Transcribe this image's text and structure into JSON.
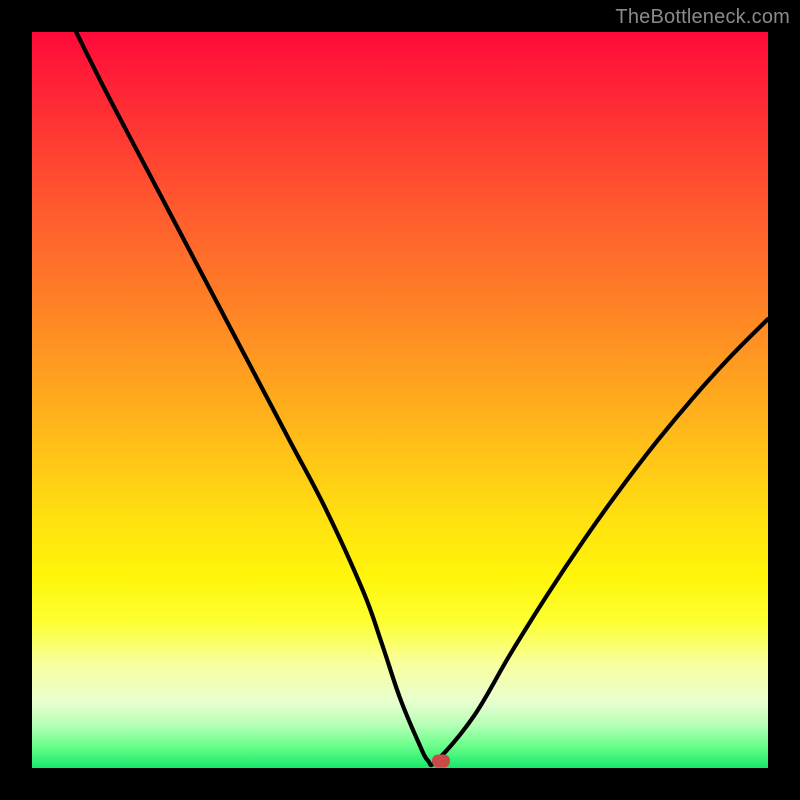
{
  "attribution": "TheBottleneck.com",
  "chart_data": {
    "type": "line",
    "title": "",
    "xlabel": "",
    "ylabel": "",
    "xlim": [
      0,
      100
    ],
    "ylim": [
      0,
      100
    ],
    "background_gradient": {
      "top": "#ff0a3a",
      "mid": "#ffe010",
      "bottom": "#17e86b"
    },
    "series": [
      {
        "name": "bottleneck-curve",
        "x": [
          6,
          10,
          15,
          20,
          25,
          30,
          35,
          40,
          45,
          47.5,
          50,
          52.5,
          53.8,
          55,
          60,
          65,
          70,
          75,
          80,
          85,
          90,
          95,
          100
        ],
        "y": [
          100,
          92,
          82.5,
          73,
          63.5,
          54,
          44.5,
          35,
          24,
          17,
          9.5,
          3.5,
          1.0,
          1.0,
          7,
          15.5,
          23.5,
          31,
          38,
          44.5,
          50.5,
          56,
          61
        ]
      }
    ],
    "flat_segment": {
      "x_start": 53.8,
      "x_end": 55.0,
      "y": 1.0
    },
    "marker": {
      "x": 55.6,
      "y": 1.0,
      "color": "#c84b49"
    },
    "annotations": []
  }
}
